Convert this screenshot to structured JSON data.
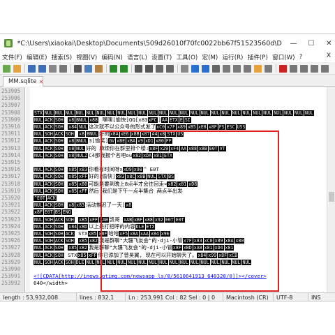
{
  "window": {
    "title": "*C:\\Users\\xiaokai\\Desktop\\Documents\\509d26010f70fc0022bb67f51523560d\\DB\\MM.sqlite - N...",
    "minimize": "—",
    "maximize": "☐",
    "close": "✕"
  },
  "menu": {
    "items": [
      "文件(F)",
      "编辑(E)",
      "搜索(S)",
      "视图(V)",
      "编码(N)",
      "语言(L)",
      "设置(T)",
      "工具(O)",
      "宏(M)",
      "运行(R)",
      "插件(P)",
      "窗口(W)",
      "?"
    ],
    "close": "X"
  },
  "toolbar": {
    "icons": [
      {
        "name": "new-file-icon",
        "color": "#6aa84f"
      },
      {
        "name": "open-file-icon",
        "color": "#e6a23c"
      },
      {
        "name": "save-icon",
        "color": "#3d6fb6"
      },
      {
        "name": "save-all-icon",
        "color": "#3d6fb6"
      },
      {
        "name": "close-file-icon",
        "color": "#888888"
      },
      {
        "name": "print-icon",
        "color": "#777777"
      },
      {
        "name": "cut-icon",
        "color": "#555555"
      },
      {
        "name": "copy-icon",
        "color": "#4a7ebb"
      },
      {
        "name": "paste-icon",
        "color": "#b08040"
      },
      {
        "name": "undo-icon",
        "color": "#2a8a2a"
      },
      {
        "name": "redo-icon",
        "color": "#2a8a2a"
      },
      {
        "name": "find-icon",
        "color": "#555555"
      },
      {
        "name": "replace-icon",
        "color": "#555555"
      },
      {
        "name": "zoom-in-icon",
        "color": "#666666"
      },
      {
        "name": "zoom-out-icon",
        "color": "#666666"
      },
      {
        "name": "sync-scroll-icon",
        "color": "#888888"
      },
      {
        "name": "word-wrap-icon",
        "color": "#2a6fd0"
      },
      {
        "name": "show-all-chars-icon",
        "color": "#2a6fd0"
      },
      {
        "name": "indent-guide-icon",
        "color": "#666666"
      },
      {
        "name": "lang-icon",
        "color": "#7a7a7a"
      },
      {
        "name": "doc-map-icon",
        "color": "#7a7a7a"
      },
      {
        "name": "function-list-icon",
        "color": "#7a7a7a"
      },
      {
        "name": "folder-workspace-icon",
        "color": "#e6a23c"
      },
      {
        "name": "monitor-icon",
        "color": "#7a7a7a"
      },
      {
        "name": "record-macro-icon",
        "color": "#cc2222"
      },
      {
        "name": "stop-macro-icon",
        "color": "#777777"
      },
      {
        "name": "play-macro-icon",
        "color": "#777777"
      },
      {
        "name": "run-macro-icon",
        "color": "#777777"
      },
      {
        "name": "save-macro-icon",
        "color": "#777777"
      }
    ]
  },
  "tab": {
    "label": "MM.sqlite",
    "close": "✕"
  },
  "lines": [
    {
      "num": "253905",
      "text": ""
    },
    {
      "num": "253906",
      "text": ""
    },
    {
      "num": "253907",
      "text": ""
    },
    {
      "num": "253908",
      "text": "STX▯NUL▯NUL▯NUL▯NUL▯NUL▯NUL▯NUL▯NUL▯NUL▯NUL▯NUL▯NUL▯NUL▯NUL▯NUL▯NUL▯NUL▯NUL▯NUL▯NUL▯NUL▯NUL▯NUL▯NUL▯NUL▯NUL"
    },
    {
      "num": "253909",
      "text": "NUL▯ACK▯SOH      ▯x8▯BNUL▯x88 嘿嘿[偷快]QQ[x83▯xFC]▯AA▯ETX▯E▯SI"
    },
    {
      "num": "253910",
      "text": "NUL▯ACK▯SOH      ▯x84▯NUL这次就不以公众号的形式发了▯xC0▯x7F▯x89▯xB5▯xE8▯x8F▯FS▯ESC▯USS"
    },
    {
      "num": "253911",
      "text": "NUL▯SOH▯ACK▯SOH          ▯x8▯BNUL好的▯x8A▯xE6▯x8B▯x87▯A4▯x8▯STX▯US"
    },
    {
      "num": "253912",
      "text": "NUL▯ACK▯SOH              ▯x8▯BNUL3[愉笑]▯GV▯xBE▯xBA▯x9▯xD1▯x80▯FF"
    },
    {
      "num": "253913",
      "text": "NUL▯ACK▯SOH      ▯x8▯NUL好的 麻烦你在群里排个楼:▯x8F▯x29▯xF4▯AA▯x88▯x8B▯E0T▯VT"
    },
    {
      "num": "253914",
      "text": "NUL▯ACK▯SOH      ▯x8▯NULZC4那我报个名吧ou▯x82▯xDA▯x81▯ETX"
    },
    {
      "num": "253915",
      "text": ""
    },
    {
      "num": "253916",
      "text": "NUL▯ACK▯SOH      ▯x85▯x83你看有时间呀x▯xD9▯x98^ E0T"
    },
    {
      "num": "253917",
      "text": "NUL▯ACK▯SOH      ▯x85▯xFF好的[偷快]▯x83▯x8C▯x8B▯NUL▯STX▯BS"
    },
    {
      "num": "253918",
      "text": "NUL▯ACK▯SOH      ▯x85▯x80可能是要到晚上8点半才会往回走<▯x82▯x81▯xD8"
    },
    {
      "num": "253919",
      "text": "NUL▯ACK▯SOH      ▯x85▯xFF然后 我们是下午一点半集合 两点半出发"
    },
    {
      "num": "253920",
      "text": "^E0T▯ACK"
    },
    {
      "num": "253921",
      "text": "NUL▯ACK▯SOH      ▯x8▯x83活动推迟了一天]▯x8"
    },
    {
      "num": "253922",
      "text": "x8F▯E0T▯BS▯ENQ"
    },
    {
      "num": "253923",
      "text": "NUL▯SOH▯ACK▯SOH          ▯x85▯xFF▯xAB凯哥      ▯xAB▯xBF▯x88▯x92▯E0T▯E0T"
    },
    {
      "num": "253924",
      "text": "NUL▯ACK▯SOH      ▯x84▯x8D以上是打招呼的内容▯DLE▯ETX"
    },
    {
      "num": "253925",
      "text": "NUL▯SOH▯SOH▯ACK  STX▯x85▯x8F哈哈▯xF5▯x8A▯xAA▯x84▯x9E"
    },
    {
      "num": "253926",
      "text": "NUL▯SOH▯ACK▯SOH      ▯x85▯x82我是群聊\"大疆飞友会\"的-dji-小管▯x7F▯x83▯xC0▯x89▯x8A▯x80"
    },
    {
      "num": "253927",
      "text": "NUL▯ACK▯SOH      ▯x85▯x82我是群聊\"大疆飞友会\"的-dji-小管▯x8F▯xBD▯xA8▯x81▯xD4▯x81"
    },
    {
      "num": "253928",
      "text": "NUL▯ACK▯SOH   STX▯x85▯xFF你已添加了曾昊翼, 现在可以开始聊天了。▯x84▯x99▯x8F▯xCB"
    },
    {
      "num": "253929",
      "text": "NUL▯SOH▯ACK▯SOH▯DLE▯NUL▯NUL▯NUL▯NUL▯NUL▯NUL▯NUL▯NUL▯NUL▯NUL▯NUL▯NUL▯NUL▯NUL▯NUL▯NUL"
    },
    {
      "num": "253990",
      "text": ""
    },
    {
      "num": "253991",
      "text": "<![CDATA[http://inews.gtimg.com/newsapp_ls/0/5610641913_640320/0]]></cover>"
    },
    {
      "num": "253992",
      "text": "640</width>"
    }
  ],
  "status": {
    "length": "length : 53,932,008",
    "lines": "lines : 832,1",
    "pos": "Ln : 253,991    Col : 82    Sel : 0 | 0",
    "eol": "Macintosh (CR)",
    "encoding": "UTF-8",
    "mode": "INS"
  },
  "highlight_color": "#e02020"
}
